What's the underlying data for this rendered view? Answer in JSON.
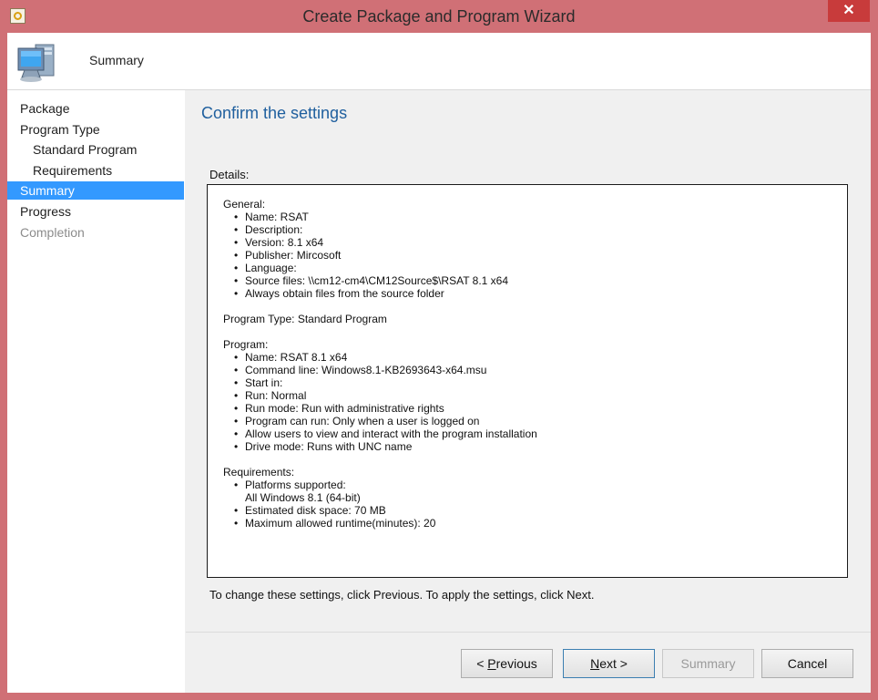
{
  "window": {
    "title": "Create Package and Program Wizard",
    "close_label": "✕"
  },
  "header": {
    "title": "Summary",
    "icon": "computer-icon"
  },
  "sidebar": {
    "items": [
      {
        "label": "Package",
        "state": "normal"
      },
      {
        "label": "Program Type",
        "state": "normal"
      },
      {
        "label": "Standard Program",
        "state": "normal"
      },
      {
        "label": "Requirements",
        "state": "normal"
      },
      {
        "label": "Summary",
        "state": "active"
      },
      {
        "label": "Progress",
        "state": "normal"
      },
      {
        "label": "Completion",
        "state": "disabled"
      }
    ]
  },
  "main": {
    "heading": "Confirm the settings",
    "details_label": "Details:",
    "details": {
      "general_head": "General:",
      "general": [
        "Name: RSAT",
        "Description:",
        "Version: 8.1 x64",
        "Publisher: Mircosoft",
        "Language:",
        "Source files: \\\\cm12-cm4\\CM12Source$\\RSAT 8.1 x64",
        "Always obtain files from the source folder"
      ],
      "program_type": "Program Type: Standard Program",
      "program_head": "Program:",
      "program": [
        "Name: RSAT 8.1 x64",
        "Command line: Windows8.1-KB2693643-x64.msu",
        "Start in:",
        "Run: Normal",
        "Run mode: Run with administrative rights",
        "Program can run: Only when a user is logged on",
        "Allow users to view and interact with the program installation",
        "Drive mode: Runs with UNC name"
      ],
      "requirements_head": "Requirements:",
      "req_platforms": "Platforms supported:",
      "req_platforms_value": "All Windows 8.1 (64-bit)",
      "req_disk": "Estimated disk space: 70 MB",
      "req_runtime": "Maximum allowed runtime(minutes): 20"
    },
    "change_hint": "To change these settings, click Previous. To apply the settings, click Next."
  },
  "footer": {
    "previous_prefix": "< ",
    "previous_accel": "P",
    "previous_rest": "revious",
    "next_accel": "N",
    "next_rest": "ext >",
    "summary_label": "Summary",
    "cancel_label": "Cancel"
  },
  "colors": {
    "frame": "#d07076",
    "active_nav": "#3399ff",
    "heading": "#1f5f9e",
    "close": "#c83b3b"
  }
}
